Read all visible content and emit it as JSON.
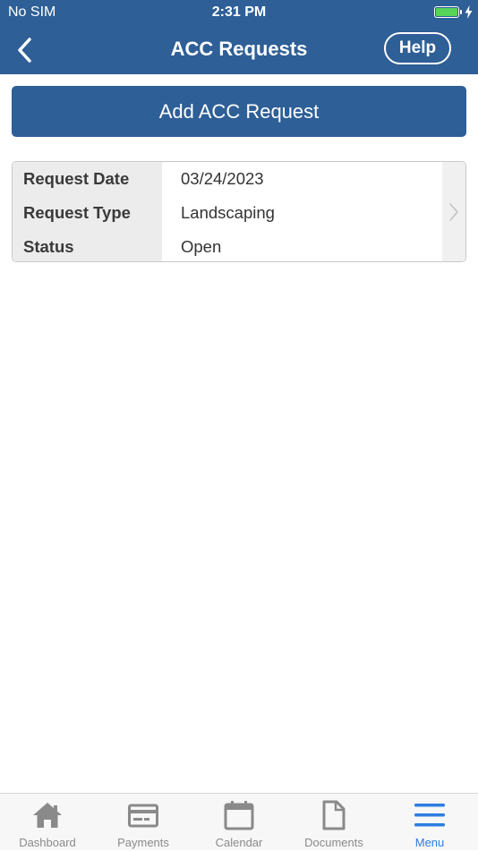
{
  "status_bar": {
    "carrier": "No SIM",
    "time": "2:31 PM"
  },
  "nav": {
    "title": "ACC Requests",
    "help_label": "Help"
  },
  "actions": {
    "add_label": "Add ACC Request"
  },
  "request": {
    "rows": [
      {
        "label": "Request Date",
        "value": "03/24/2023"
      },
      {
        "label": "Request Type",
        "value": "Landscaping"
      },
      {
        "label": "Status",
        "value": "Open"
      }
    ]
  },
  "tabs": [
    {
      "label": "Dashboard",
      "icon": "home-icon"
    },
    {
      "label": "Payments",
      "icon": "credit-card-icon"
    },
    {
      "label": "Calendar",
      "icon": "calendar-icon"
    },
    {
      "label": "Documents",
      "icon": "document-icon"
    },
    {
      "label": "Menu",
      "icon": "menu-icon",
      "active": true
    }
  ],
  "colors": {
    "brand": "#2e5f96",
    "active_tab": "#2d7de0",
    "inactive_tab": "#8a8a8a",
    "battery": "#58d35a"
  }
}
